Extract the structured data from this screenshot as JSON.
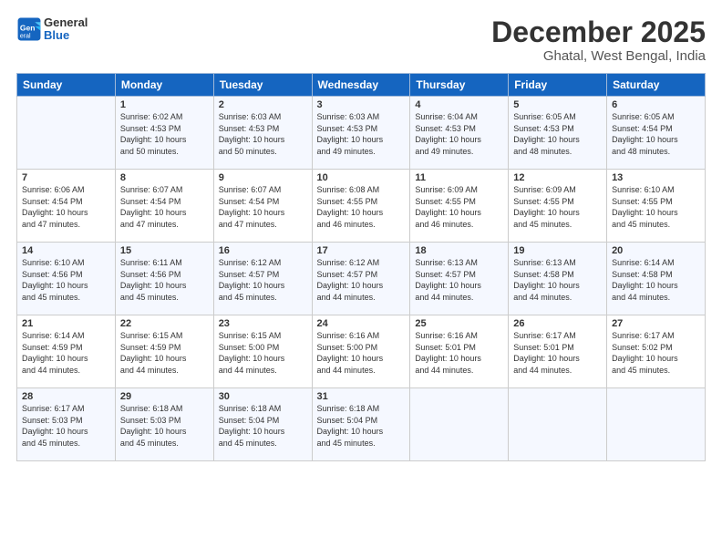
{
  "logo": {
    "line1": "General",
    "line2": "Blue"
  },
  "header": {
    "month": "December 2025",
    "location": "Ghatal, West Bengal, India"
  },
  "weekdays": [
    "Sunday",
    "Monday",
    "Tuesday",
    "Wednesday",
    "Thursday",
    "Friday",
    "Saturday"
  ],
  "weeks": [
    [
      {
        "day": "",
        "info": ""
      },
      {
        "day": "1",
        "info": "Sunrise: 6:02 AM\nSunset: 4:53 PM\nDaylight: 10 hours\nand 50 minutes."
      },
      {
        "day": "2",
        "info": "Sunrise: 6:03 AM\nSunset: 4:53 PM\nDaylight: 10 hours\nand 50 minutes."
      },
      {
        "day": "3",
        "info": "Sunrise: 6:03 AM\nSunset: 4:53 PM\nDaylight: 10 hours\nand 49 minutes."
      },
      {
        "day": "4",
        "info": "Sunrise: 6:04 AM\nSunset: 4:53 PM\nDaylight: 10 hours\nand 49 minutes."
      },
      {
        "day": "5",
        "info": "Sunrise: 6:05 AM\nSunset: 4:53 PM\nDaylight: 10 hours\nand 48 minutes."
      },
      {
        "day": "6",
        "info": "Sunrise: 6:05 AM\nSunset: 4:54 PM\nDaylight: 10 hours\nand 48 minutes."
      }
    ],
    [
      {
        "day": "7",
        "info": "Sunrise: 6:06 AM\nSunset: 4:54 PM\nDaylight: 10 hours\nand 47 minutes."
      },
      {
        "day": "8",
        "info": "Sunrise: 6:07 AM\nSunset: 4:54 PM\nDaylight: 10 hours\nand 47 minutes."
      },
      {
        "day": "9",
        "info": "Sunrise: 6:07 AM\nSunset: 4:54 PM\nDaylight: 10 hours\nand 47 minutes."
      },
      {
        "day": "10",
        "info": "Sunrise: 6:08 AM\nSunset: 4:55 PM\nDaylight: 10 hours\nand 46 minutes."
      },
      {
        "day": "11",
        "info": "Sunrise: 6:09 AM\nSunset: 4:55 PM\nDaylight: 10 hours\nand 46 minutes."
      },
      {
        "day": "12",
        "info": "Sunrise: 6:09 AM\nSunset: 4:55 PM\nDaylight: 10 hours\nand 45 minutes."
      },
      {
        "day": "13",
        "info": "Sunrise: 6:10 AM\nSunset: 4:55 PM\nDaylight: 10 hours\nand 45 minutes."
      }
    ],
    [
      {
        "day": "14",
        "info": "Sunrise: 6:10 AM\nSunset: 4:56 PM\nDaylight: 10 hours\nand 45 minutes."
      },
      {
        "day": "15",
        "info": "Sunrise: 6:11 AM\nSunset: 4:56 PM\nDaylight: 10 hours\nand 45 minutes."
      },
      {
        "day": "16",
        "info": "Sunrise: 6:12 AM\nSunset: 4:57 PM\nDaylight: 10 hours\nand 45 minutes."
      },
      {
        "day": "17",
        "info": "Sunrise: 6:12 AM\nSunset: 4:57 PM\nDaylight: 10 hours\nand 44 minutes."
      },
      {
        "day": "18",
        "info": "Sunrise: 6:13 AM\nSunset: 4:57 PM\nDaylight: 10 hours\nand 44 minutes."
      },
      {
        "day": "19",
        "info": "Sunrise: 6:13 AM\nSunset: 4:58 PM\nDaylight: 10 hours\nand 44 minutes."
      },
      {
        "day": "20",
        "info": "Sunrise: 6:14 AM\nSunset: 4:58 PM\nDaylight: 10 hours\nand 44 minutes."
      }
    ],
    [
      {
        "day": "21",
        "info": "Sunrise: 6:14 AM\nSunset: 4:59 PM\nDaylight: 10 hours\nand 44 minutes."
      },
      {
        "day": "22",
        "info": "Sunrise: 6:15 AM\nSunset: 4:59 PM\nDaylight: 10 hours\nand 44 minutes."
      },
      {
        "day": "23",
        "info": "Sunrise: 6:15 AM\nSunset: 5:00 PM\nDaylight: 10 hours\nand 44 minutes."
      },
      {
        "day": "24",
        "info": "Sunrise: 6:16 AM\nSunset: 5:00 PM\nDaylight: 10 hours\nand 44 minutes."
      },
      {
        "day": "25",
        "info": "Sunrise: 6:16 AM\nSunset: 5:01 PM\nDaylight: 10 hours\nand 44 minutes."
      },
      {
        "day": "26",
        "info": "Sunrise: 6:17 AM\nSunset: 5:01 PM\nDaylight: 10 hours\nand 44 minutes."
      },
      {
        "day": "27",
        "info": "Sunrise: 6:17 AM\nSunset: 5:02 PM\nDaylight: 10 hours\nand 45 minutes."
      }
    ],
    [
      {
        "day": "28",
        "info": "Sunrise: 6:17 AM\nSunset: 5:03 PM\nDaylight: 10 hours\nand 45 minutes."
      },
      {
        "day": "29",
        "info": "Sunrise: 6:18 AM\nSunset: 5:03 PM\nDaylight: 10 hours\nand 45 minutes."
      },
      {
        "day": "30",
        "info": "Sunrise: 6:18 AM\nSunset: 5:04 PM\nDaylight: 10 hours\nand 45 minutes."
      },
      {
        "day": "31",
        "info": "Sunrise: 6:18 AM\nSunset: 5:04 PM\nDaylight: 10 hours\nand 45 minutes."
      },
      {
        "day": "",
        "info": ""
      },
      {
        "day": "",
        "info": ""
      },
      {
        "day": "",
        "info": ""
      }
    ]
  ]
}
